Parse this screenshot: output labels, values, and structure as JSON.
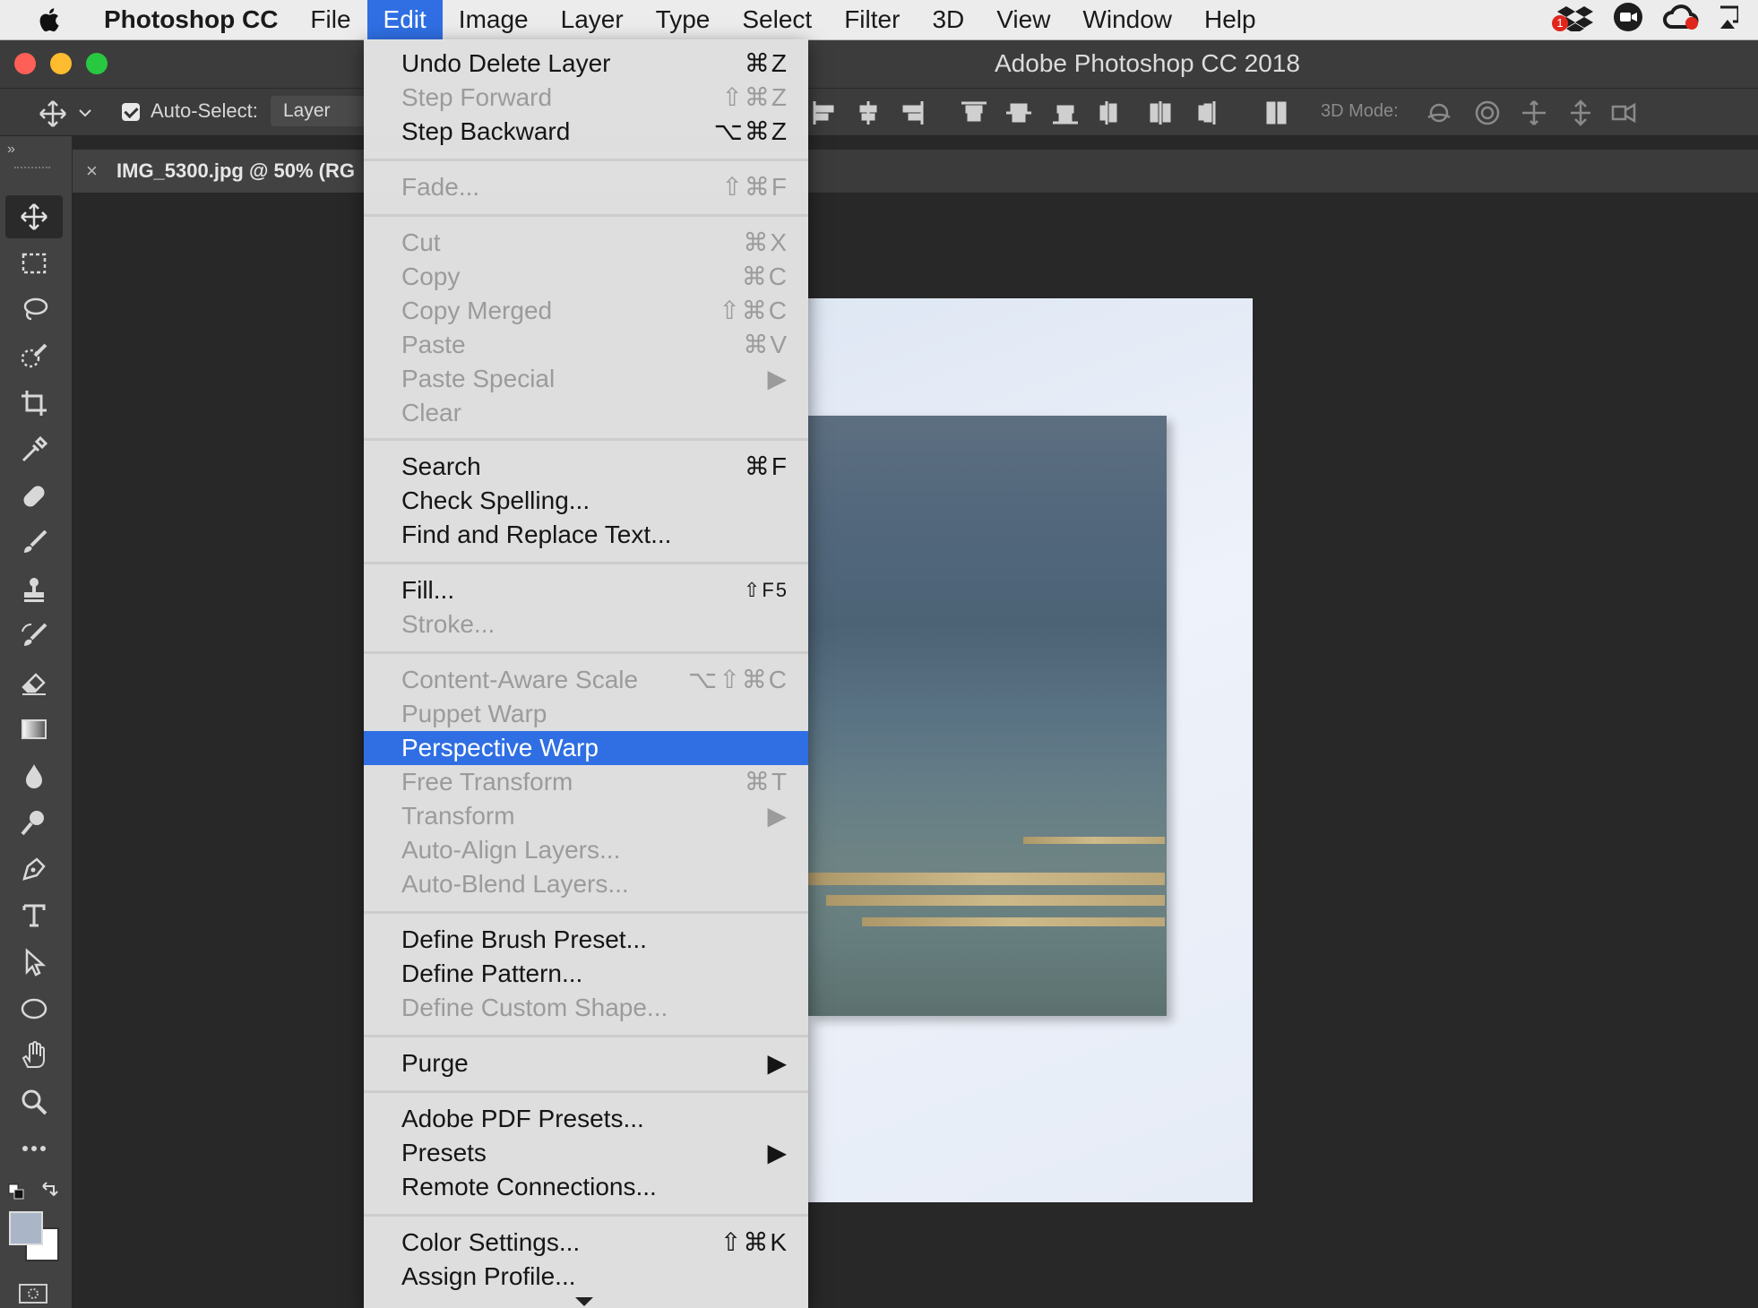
{
  "menubar": {
    "app": "Photoshop CC",
    "menus": [
      "File",
      "Edit",
      "Image",
      "Layer",
      "Type",
      "Select",
      "Filter",
      "3D",
      "View",
      "Window",
      "Help"
    ],
    "active_menu": "Edit",
    "status_icons": [
      "dropbox-icon",
      "facetime-icon",
      "creative-cloud-icon",
      "airplay-icon"
    ],
    "notification_badge": "1"
  },
  "window": {
    "title": "Adobe Photoshop CC 2018"
  },
  "options_bar": {
    "auto_select_label": "Auto-Select:",
    "auto_select_checked": true,
    "auto_select_target": "Layer",
    "mode_3d_label": "3D Mode:"
  },
  "document_tab": {
    "close": "×",
    "name": "IMG_5300.jpg @ 50% (RG"
  },
  "toolbox": {
    "collapse": "»",
    "tools": [
      "move-tool",
      "marquee-tool",
      "lasso-tool",
      "quick-selection-tool",
      "crop-tool",
      "eyedropper-tool",
      "healing-brush-tool",
      "brush-tool",
      "clone-stamp-tool",
      "history-brush-tool",
      "eraser-tool",
      "gradient-tool",
      "blur-tool",
      "dodge-tool",
      "pen-tool",
      "type-tool",
      "path-selection-tool",
      "ellipse-tool",
      "hand-tool",
      "zoom-tool",
      "more-tools"
    ],
    "foreground_color": "#aab5c8",
    "background_color": "#ffffff"
  },
  "edit_menu": {
    "items": [
      {
        "label": "Undo Delete Layer",
        "shortcut": "⌘Z",
        "enabled": true
      },
      {
        "label": "Step Forward",
        "shortcut": "⇧⌘Z",
        "enabled": false
      },
      {
        "label": "Step Backward",
        "shortcut": "⌥⌘Z",
        "enabled": true
      },
      {
        "label": "Fade...",
        "shortcut": "⇧⌘F",
        "enabled": false
      },
      {
        "label": "Cut",
        "shortcut": "⌘X",
        "enabled": false
      },
      {
        "label": "Copy",
        "shortcut": "⌘C",
        "enabled": false
      },
      {
        "label": "Copy Merged",
        "shortcut": "⇧⌘C",
        "enabled": false
      },
      {
        "label": "Paste",
        "shortcut": "⌘V",
        "enabled": false
      },
      {
        "label": "Paste Special",
        "shortcut": "▶",
        "enabled": false
      },
      {
        "label": "Clear",
        "shortcut": "",
        "enabled": false
      },
      {
        "label": "Search",
        "shortcut": "⌘F",
        "enabled": true
      },
      {
        "label": "Check Spelling...",
        "shortcut": "",
        "enabled": true
      },
      {
        "label": "Find and Replace Text...",
        "shortcut": "",
        "enabled": true
      },
      {
        "label": "Fill...",
        "shortcut": "⇧F5",
        "enabled": true
      },
      {
        "label": "Stroke...",
        "shortcut": "",
        "enabled": false
      },
      {
        "label": "Content-Aware Scale",
        "shortcut": "⌥⇧⌘C",
        "enabled": false
      },
      {
        "label": "Puppet Warp",
        "shortcut": "",
        "enabled": false
      },
      {
        "label": "Perspective Warp",
        "shortcut": "",
        "enabled": true,
        "highlighted": true
      },
      {
        "label": "Free Transform",
        "shortcut": "⌘T",
        "enabled": false
      },
      {
        "label": "Transform",
        "shortcut": "▶",
        "enabled": false
      },
      {
        "label": "Auto-Align Layers...",
        "shortcut": "",
        "enabled": false
      },
      {
        "label": "Auto-Blend Layers...",
        "shortcut": "",
        "enabled": false
      },
      {
        "label": "Define Brush Preset...",
        "shortcut": "",
        "enabled": true
      },
      {
        "label": "Define Pattern...",
        "shortcut": "",
        "enabled": true
      },
      {
        "label": "Define Custom Shape...",
        "shortcut": "",
        "enabled": false
      },
      {
        "label": "Purge",
        "shortcut": "▶",
        "enabled": true
      },
      {
        "label": "Adobe PDF Presets...",
        "shortcut": "",
        "enabled": true
      },
      {
        "label": "Presets",
        "shortcut": "▶",
        "enabled": true
      },
      {
        "label": "Remote Connections...",
        "shortcut": "",
        "enabled": true
      },
      {
        "label": "Color Settings...",
        "shortcut": "⇧⌘K",
        "enabled": true
      },
      {
        "label": "Assign Profile...",
        "shortcut": "",
        "enabled": true
      }
    ]
  },
  "colors": {
    "accent": "#2f6fe3",
    "traffic_red": "#fe5f57",
    "traffic_yellow": "#febc2e",
    "traffic_green": "#28c840"
  }
}
